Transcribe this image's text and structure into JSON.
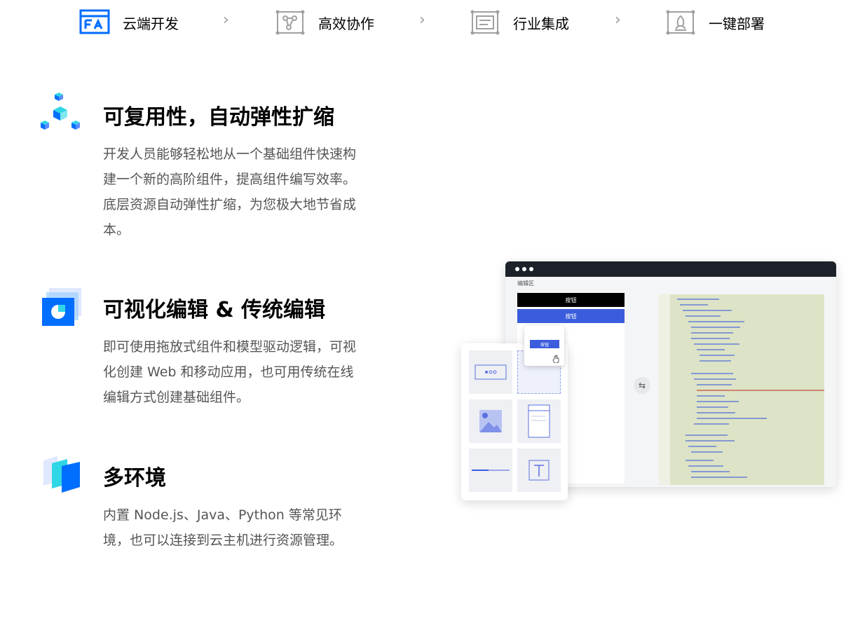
{
  "steps": [
    {
      "label": "云端开发",
      "icon": "cloud-dev-icon"
    },
    {
      "label": "高效协作",
      "icon": "collab-icon"
    },
    {
      "label": "行业集成",
      "icon": "integration-icon"
    },
    {
      "label": "一键部署",
      "icon": "deploy-icon"
    }
  ],
  "features": [
    {
      "title": "可复用性，自动弹性扩缩",
      "desc": "开发人员能够轻松地从一个基础组件快速构建一个新的高阶组件，提高组件编写效率。底层资源自动弹性扩缩，为您极大地节省成本。"
    },
    {
      "title": "可视化编辑 & 传统编辑",
      "desc": "即可使用拖放式组件和模型驱动逻辑，可视化创建 Web 和移动应用，也可用传统在线编辑方式创建基础组件。"
    },
    {
      "title": "多环境",
      "desc": "内置 Node.js、Java、Python 等常见环境，也可以连接到云主机进行资源管理。"
    }
  ],
  "illustration": {
    "edit_area_label": "编辑区",
    "button_label_1": "按钮",
    "button_label_2": "按钮",
    "popup_button_label": "按钮"
  },
  "colors": {
    "accent": "#006eff",
    "secondary": "#2fd6e6",
    "ui_blue": "#3b5ddd"
  }
}
